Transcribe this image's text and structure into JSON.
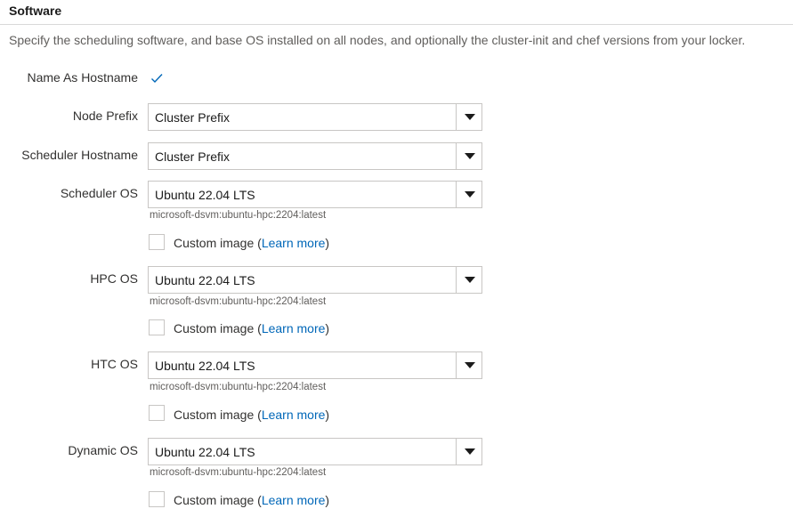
{
  "section": {
    "title": "Software",
    "description": "Specify the scheduling software, and base OS installed on all nodes, and optionally the cluster-init and chef versions from your locker."
  },
  "name_as_hostname": {
    "label": "Name As Hostname",
    "checked": true
  },
  "node_prefix": {
    "label": "Node Prefix",
    "value": "Cluster Prefix"
  },
  "scheduler_hostname": {
    "label": "Scheduler Hostname",
    "value": "Cluster Prefix"
  },
  "scheduler_os": {
    "label": "Scheduler OS",
    "value": "Ubuntu 22.04 LTS",
    "image": "microsoft-dsvm:ubuntu-hpc:2204:latest",
    "custom_image": {
      "prefix": "Custom image (",
      "link": "Learn more",
      "suffix": ")",
      "checked": false
    }
  },
  "hpc_os": {
    "label": "HPC OS",
    "value": "Ubuntu 22.04 LTS",
    "image": "microsoft-dsvm:ubuntu-hpc:2204:latest",
    "custom_image": {
      "prefix": "Custom image (",
      "link": "Learn more",
      "suffix": ")",
      "checked": false
    }
  },
  "htc_os": {
    "label": "HTC OS",
    "value": "Ubuntu 22.04 LTS",
    "image": "microsoft-dsvm:ubuntu-hpc:2204:latest",
    "custom_image": {
      "prefix": "Custom image (",
      "link": "Learn more",
      "suffix": ")",
      "checked": false
    }
  },
  "dynamic_os": {
    "label": "Dynamic OS",
    "value": "Ubuntu 22.04 LTS",
    "image": "microsoft-dsvm:ubuntu-hpc:2204:latest",
    "custom_image": {
      "prefix": "Custom image (",
      "link": "Learn more",
      "suffix": ")",
      "checked": false
    }
  },
  "colors": {
    "link": "#0067b8",
    "check": "#0067b8",
    "border": "#c8c6c4"
  },
  "icons": {
    "checkmark": "check-icon",
    "dropdown": "chevron-down-icon"
  }
}
